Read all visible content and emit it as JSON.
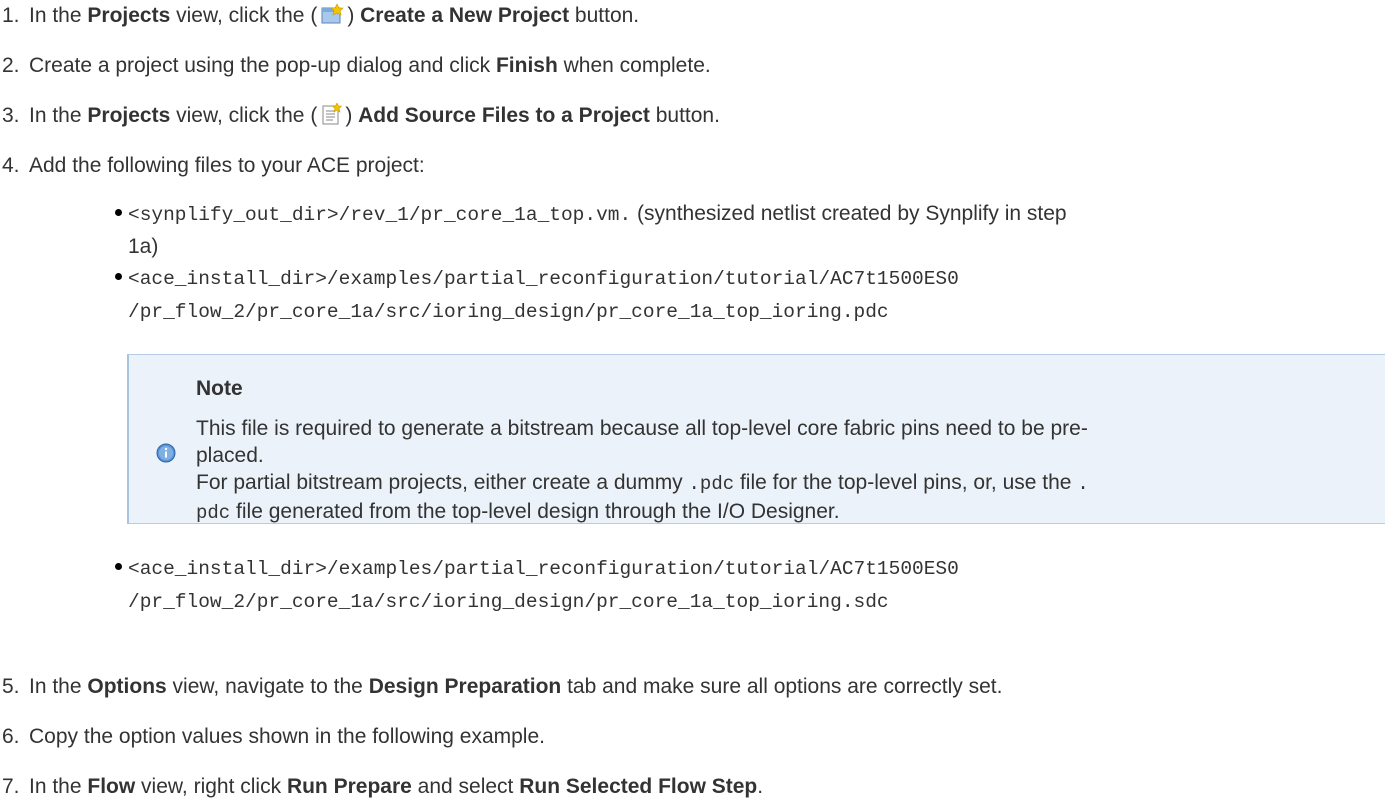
{
  "steps": [
    {
      "num": "1.",
      "pre": "In the ",
      "b1": "Projects",
      "mid": " view, click the (",
      "post": ") ",
      "b2": "Create a New Project",
      "end": " button.",
      "icon": "new-project-icon"
    },
    {
      "num": "2.",
      "pre": "Create a project using the pop-up dialog and click ",
      "b1": "Finish",
      "end": " when complete."
    },
    {
      "num": "3.",
      "pre": "In the ",
      "b1": "Projects",
      "mid": " view, click the (",
      "post": ") ",
      "b2": "Add Source Files to a Project",
      "end": " button.",
      "icon": "add-source-files-icon"
    },
    {
      "num": "4.",
      "pre": "Add the following files to your ACE project:"
    },
    {
      "num": "5.",
      "pre": "In the ",
      "b1": "Options",
      "mid": " view, navigate to the ",
      "b2": "Design Preparation",
      "end": " tab and make sure all options are correctly set."
    },
    {
      "num": "6.",
      "pre": "Copy the option values shown in the following example."
    },
    {
      "num": "7.",
      "pre": "In the ",
      "b1": "Flow",
      "mid": " view, right click ",
      "b2": "Run Prepare",
      "mid2": " and select ",
      "b3": "Run Selected Flow Step",
      "end": "."
    }
  ],
  "files": [
    {
      "path": "<synplify_out_dir>/rev_1/pr_core_1a_top.vm.",
      "desc": " (synthesized netlist created by Synplify in step",
      "desc2": "1a)"
    },
    {
      "path": "<ace_install_dir>/examples/partial_reconfiguration/tutorial/AC7t1500ES0",
      "path2": "/pr_flow_2/pr_core_1a/src/ioring_design/pr_core_1a_top_ioring.pdc"
    },
    {
      "path": "<ace_install_dir>/examples/partial_reconfiguration/tutorial/AC7t1500ES0",
      "path2": "/pr_flow_2/pr_core_1a/src/ioring_design/pr_core_1a_top_ioring.sdc"
    }
  ],
  "note": {
    "title": "Note",
    "line1": "This file is required to generate a bitstream because all top-level core fabric pins need to be pre-",
    "line2": "placed.",
    "line3a": "For partial bitstream projects, either create a dummy ",
    "line3code": ".pdc",
    "line3b": " file for the top-level pins, or, use the ",
    "line3code2": ".",
    "line4code": "pdc",
    "line4b": " file generated from the top-level design through the I/O Designer.",
    "icon": "info-icon"
  },
  "colors": {
    "note_bg": "#ebf2f9",
    "note_border": "#a7c3e0",
    "info_icon": "#3f7fc4"
  }
}
